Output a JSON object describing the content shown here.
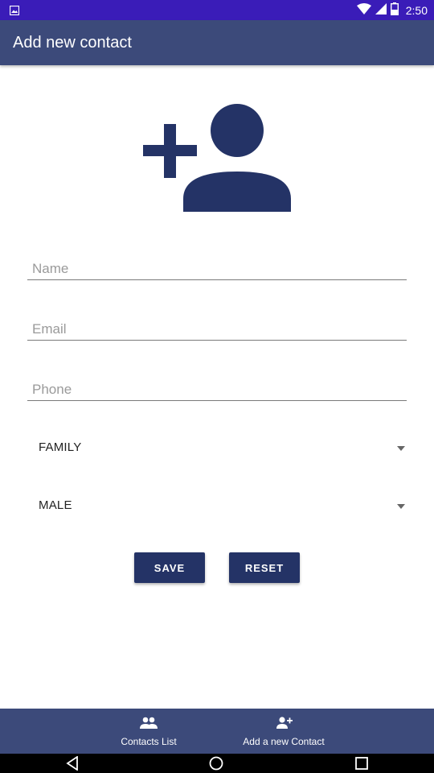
{
  "status_bar": {
    "time": "2:50",
    "icons": [
      "image-notification-icon",
      "wifi-icon",
      "signal-icon",
      "battery-icon"
    ]
  },
  "app_bar": {
    "title": "Add new contact"
  },
  "hero": {
    "icon": "add-person-icon",
    "color": "#243366"
  },
  "form": {
    "name_placeholder": "Name",
    "email_placeholder": "Email",
    "phone_placeholder": "Phone",
    "category_selected": "FAMILY",
    "gender_selected": "MALE",
    "save_label": "SAVE",
    "reset_label": "RESET"
  },
  "bottom_nav": {
    "items": [
      {
        "label": "Contacts List",
        "icon": "people-icon"
      },
      {
        "label": "Add a new Contact",
        "icon": "person-add-icon"
      }
    ]
  },
  "system_nav": {
    "icons": [
      "back-icon",
      "home-icon",
      "recents-icon"
    ]
  },
  "colors": {
    "status_bar": "#3a1cb8",
    "app_bar": "#3c4a7a",
    "accent": "#243366",
    "background": "#ffffff"
  }
}
